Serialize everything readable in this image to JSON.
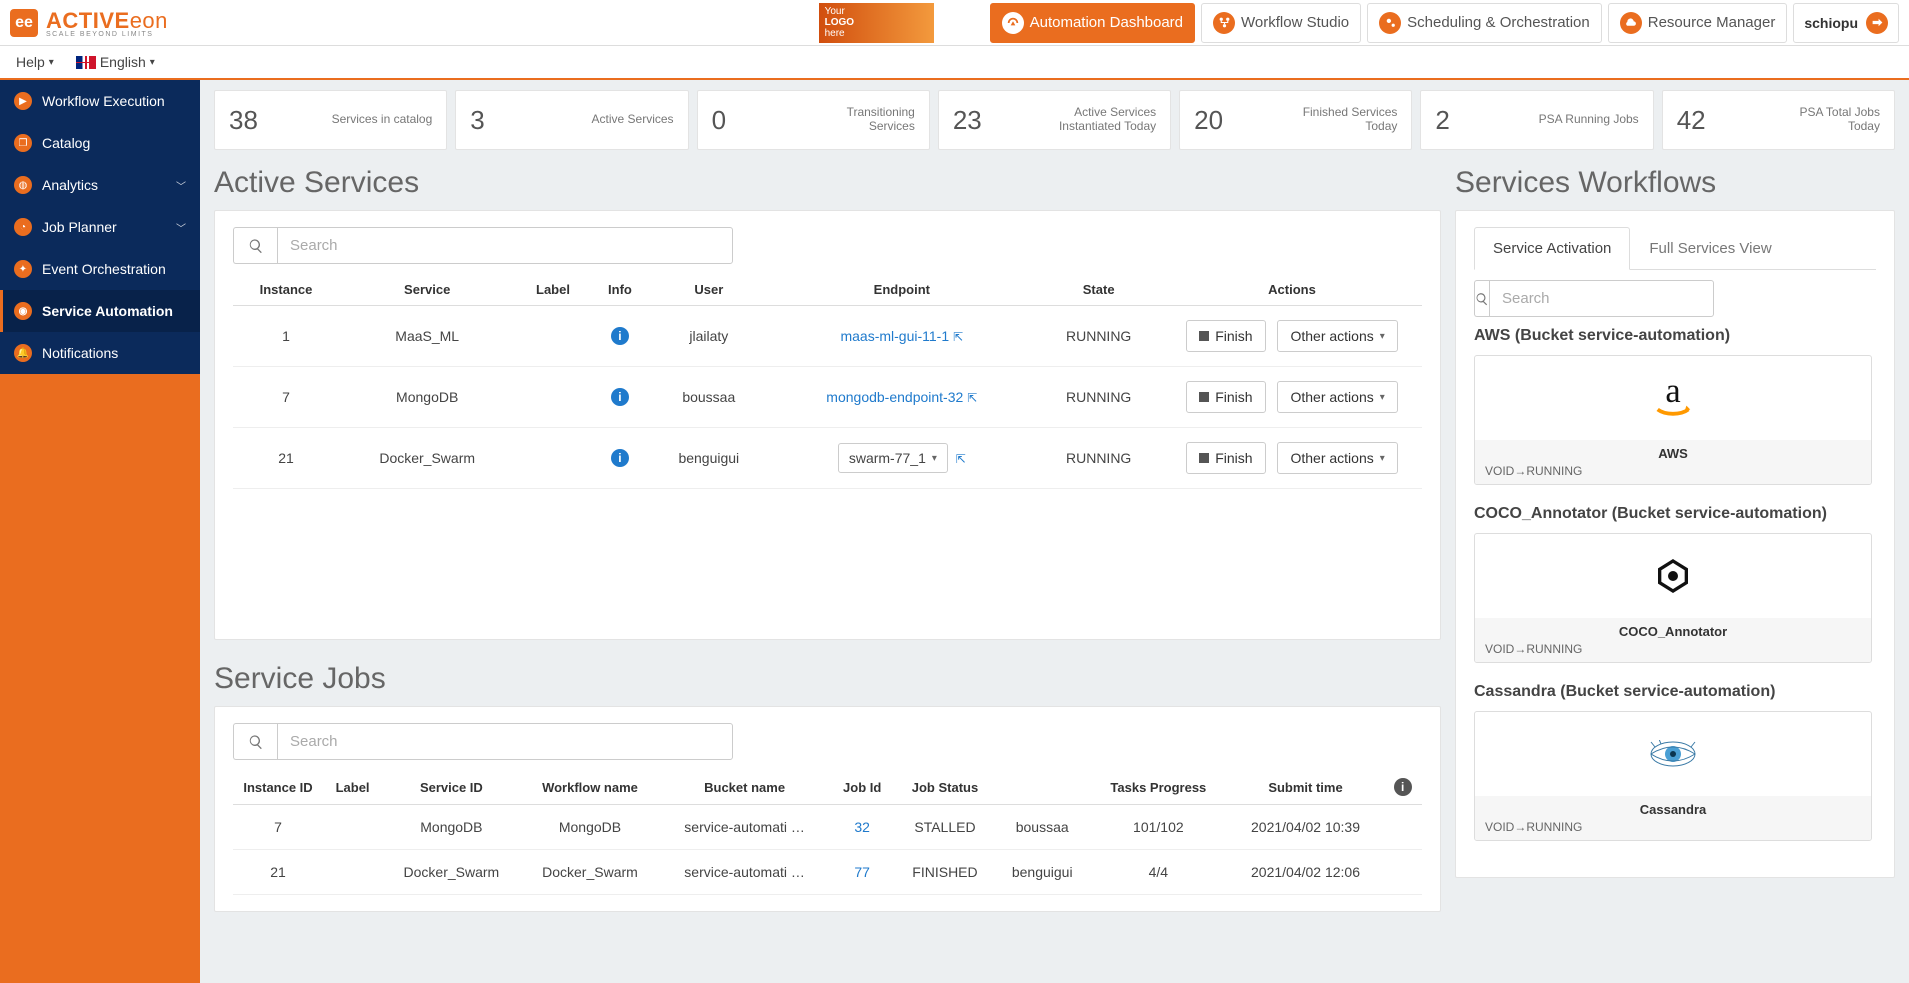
{
  "topnav": {
    "automation_dashboard": "Automation Dashboard",
    "workflow_studio": "Workflow Studio",
    "scheduling": "Scheduling & Orchestration",
    "resource_manager": "Resource Manager",
    "user": "schiopu",
    "your_logo_l1": "Your",
    "your_logo_l2": "LOGO",
    "your_logo_l3": "here"
  },
  "secondbar": {
    "help": "Help",
    "language": "English"
  },
  "sidebar": {
    "items": [
      "Workflow Execution",
      "Catalog",
      "Analytics",
      "Job Planner",
      "Event Orchestration",
      "Service Automation",
      "Notifications"
    ]
  },
  "stats": [
    {
      "num": "38",
      "lbl": "Services in catalog"
    },
    {
      "num": "3",
      "lbl": "Active Services"
    },
    {
      "num": "0",
      "lbl": "Transitioning Services"
    },
    {
      "num": "23",
      "lbl": "Active Services Instantiated Today"
    },
    {
      "num": "20",
      "lbl": "Finished Services Today"
    },
    {
      "num": "2",
      "lbl": "PSA Running Jobs"
    },
    {
      "num": "42",
      "lbl": "PSA Total Jobs Today"
    }
  ],
  "active_services": {
    "title": "Active Services",
    "search_placeholder": "Search",
    "headers": [
      "Instance",
      "Service",
      "Label",
      "Info",
      "User",
      "Endpoint",
      "State",
      "Actions"
    ],
    "rows": [
      {
        "instance": "1",
        "service": "MaaS_ML",
        "label": "",
        "user": "jlailaty",
        "endpoint": "maas-ml-gui-11-1",
        "endpoint_type": "link",
        "state": "RUNNING"
      },
      {
        "instance": "7",
        "service": "MongoDB",
        "label": "",
        "user": "boussaa",
        "endpoint": "mongodb-endpoint-32",
        "endpoint_type": "link",
        "state": "RUNNING"
      },
      {
        "instance": "21",
        "service": "Docker_Swarm",
        "label": "",
        "user": "benguigui",
        "endpoint": "swarm-77_1",
        "endpoint_type": "dropdown",
        "state": "RUNNING"
      }
    ],
    "finish_btn": "Finish",
    "other_actions_btn": "Other actions"
  },
  "service_jobs": {
    "title": "Service Jobs",
    "search_placeholder": "Search",
    "headers": [
      "Instance ID",
      "Label",
      "Service ID",
      "Workflow name",
      "Bucket name",
      "Job Id",
      "Job Status",
      "",
      "Tasks Progress",
      "Submit time",
      ""
    ],
    "rows": [
      {
        "instance": "7",
        "label": "",
        "service": "MongoDB",
        "workflow": "MongoDB",
        "bucket": "service-automati …",
        "job_id": "32",
        "status": "STALLED",
        "user": "boussaa",
        "tasks": "101/102",
        "time": "2021/04/02 10:39"
      },
      {
        "instance": "21",
        "label": "",
        "service": "Docker_Swarm",
        "workflow": "Docker_Swarm",
        "bucket": "service-automati …",
        "job_id": "77",
        "status": "FINISHED",
        "user": "benguigui",
        "tasks": "4/4",
        "time": "2021/04/02 12:06"
      }
    ]
  },
  "workflows": {
    "title": "Services Workflows",
    "tab_activation": "Service Activation",
    "tab_full": "Full Services View",
    "search_placeholder": "Search",
    "cards": [
      {
        "title": "AWS (Bucket service-automation)",
        "name": "AWS",
        "status": "VOID→RUNNING",
        "glyph": "aws"
      },
      {
        "title": "COCO_Annotator (Bucket service-automation)",
        "name": "COCO_Annotator",
        "status": "VOID→RUNNING",
        "glyph": "coco"
      },
      {
        "title": "Cassandra (Bucket service-automation)",
        "name": "Cassandra",
        "status": "VOID→RUNNING",
        "glyph": "eye"
      }
    ]
  }
}
